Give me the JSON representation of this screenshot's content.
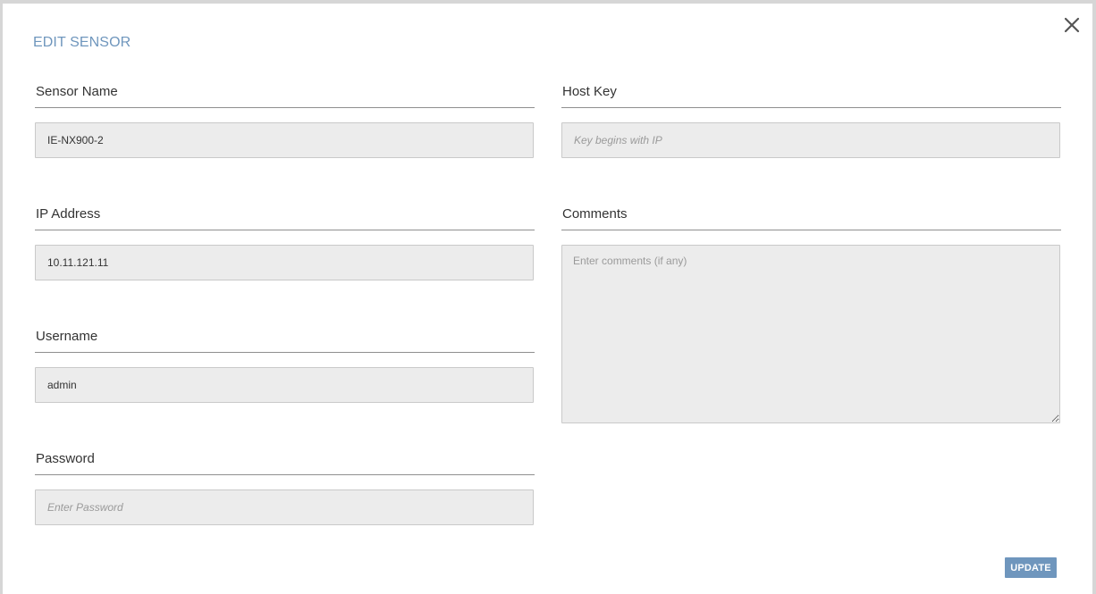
{
  "modal": {
    "title": "EDIT SENSOR",
    "close_icon": "close-icon"
  },
  "fields": {
    "sensor_name": {
      "label": "Sensor Name",
      "value": "IE-NX900-2",
      "placeholder": ""
    },
    "ip_address": {
      "label": "IP Address",
      "value": "10.11.121.11",
      "placeholder": ""
    },
    "username": {
      "label": "Username",
      "value": "admin",
      "placeholder": ""
    },
    "password": {
      "label": "Password",
      "value": "",
      "placeholder": "Enter Password"
    },
    "host_key": {
      "label": "Host Key",
      "value": "",
      "placeholder": "Key begins with IP"
    },
    "comments": {
      "label": "Comments",
      "value": "",
      "placeholder": "Enter comments (if any)"
    }
  },
  "actions": {
    "update_label": "UPDATE"
  },
  "colors": {
    "accent": "#6f96bd",
    "input_background": "#ececec",
    "label_text": "#333333"
  }
}
